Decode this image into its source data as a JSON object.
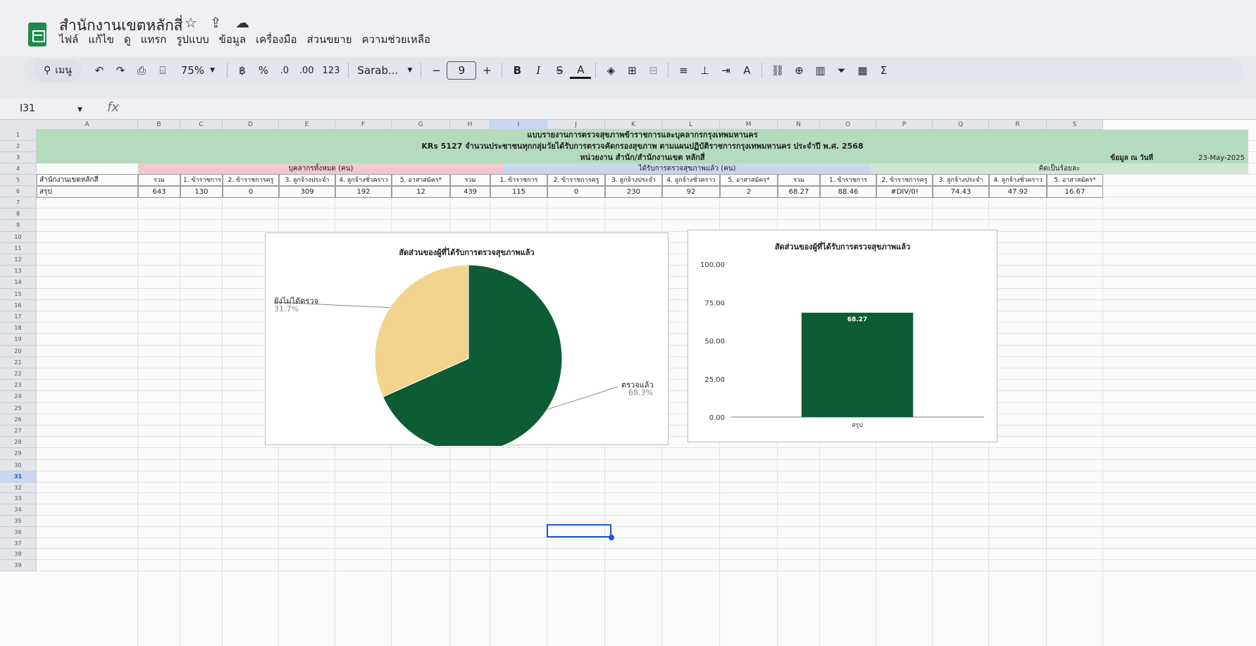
{
  "app": {
    "title": "สำนักงานเขตหลักสี่"
  },
  "menu": [
    "ไฟล์",
    "แก้ไข",
    "ดู",
    "แทรก",
    "รูปแบบ",
    "ข้อมูล",
    "เครื่องมือ",
    "ส่วนขยาย",
    "ความช่วยเหลือ"
  ],
  "toolbar": {
    "search": "เมนู",
    "zoom": "75%",
    "percent": "%",
    "dec_minus": ".0",
    "dec_plus": ".00",
    "number": "123",
    "font": "Sarab...",
    "font_size": "9",
    "bold": "B",
    "italic": "I",
    "font_color": "A"
  },
  "formula": {
    "name_box": "I31",
    "fx": "fx"
  },
  "columns": [
    "A",
    "B",
    "C",
    "D",
    "E",
    "F",
    "G",
    "H",
    "I",
    "J",
    "K",
    "L",
    "M",
    "N",
    "O",
    "P",
    "Q",
    "R",
    "S"
  ],
  "rows": [
    "1",
    "2",
    "3",
    "4",
    "5",
    "6",
    "7",
    "8",
    "9",
    "10",
    "11",
    "12",
    "13",
    "14",
    "15",
    "16",
    "17",
    "18",
    "19",
    "20",
    "21",
    "22",
    "23",
    "24",
    "25",
    "26",
    "27",
    "28",
    "29",
    "30",
    "31",
    "32",
    "33",
    "34",
    "35",
    "36",
    "37",
    "38",
    "39"
  ],
  "report": {
    "row1": "แบบรายงานการตรวจสุขภาพข้าราชการและบุคลากรกรุงเทพมหานคร",
    "row2": "KRs 5127 จำนวนประชาชนทุกกลุ่มวัยได้รับการตรวจคัดกรองสุขภาพ ตามแผนปฏิบัติราชการกรุงเทพมหานคร ประจำปี พ.ศ. 2568",
    "row3": "หน่วยงาน สำนัก/สำนักงานเขต หลักสี่",
    "date_label": "ข้อมูล ณ วันที่",
    "date_value": "23-May-2025",
    "group_staff": "บุคลากรทั้งหมด (คน)",
    "group_checked": "ได้รับการตรวจสุขภาพแล้ว (คน)",
    "group_percent": "คิดเป็นร้อยละ",
    "office_label": "สำนักงานเขตหลักสี่",
    "summary_label": "สรุป",
    "headers": [
      "รวม",
      "1. ข้าราชการ",
      "2. ข้าราชการครู",
      "3. ลูกจ้างประจำ",
      "4. ลูกจ้างชั่วคราว",
      "5. อาสาสมัคร*"
    ],
    "staff_values": [
      "643",
      "130",
      "0",
      "309",
      "192",
      "12"
    ],
    "checked_values": [
      "439",
      "115",
      "0",
      "230",
      "92",
      "2"
    ],
    "percent_values": [
      "68.27",
      "88.46",
      "#DIV/0!",
      "74.43",
      "47.92",
      "16.67"
    ]
  },
  "colors": {
    "dark_green": "#0e5c33",
    "pie_yellow": "#f2d48f",
    "selection_blue": "#1a57c7"
  },
  "chart_data": [
    {
      "type": "pie",
      "title": "สัดส่วนของผู้ที่ได้รับการตรวจสุขภาพแล้ว",
      "slices": [
        {
          "label": "ตรวจแล้ว",
          "value": 68.3,
          "display": "68.3%",
          "color": "#0e5c33"
        },
        {
          "label": "ยังไม่ได้ตรวจ",
          "value": 31.7,
          "display": "31.7%",
          "color": "#f2d48f"
        }
      ]
    },
    {
      "type": "bar",
      "title": "สัดส่วนของผู้ที่ได้รับการตรวจสุขภาพแล้ว",
      "categories": [
        "สรุป"
      ],
      "values": [
        68.27
      ],
      "value_labels": [
        "68.27"
      ],
      "ylim": [
        0,
        100
      ],
      "yticks": [
        "0.00",
        "25.00",
        "50.00",
        "75.00",
        "100.00"
      ],
      "color": "#0e5c33"
    }
  ]
}
